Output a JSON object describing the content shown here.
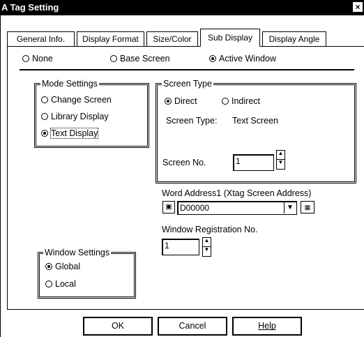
{
  "window": {
    "title": "A Tag Setting",
    "close": "×"
  },
  "tabs": [
    {
      "label": "General Info."
    },
    {
      "label": "Display Format"
    },
    {
      "label": "Size/Color"
    },
    {
      "label": "Sub Display"
    },
    {
      "label": "Display Angle"
    }
  ],
  "display_mode": {
    "none": "None",
    "base_screen": "Base Screen",
    "active_window": "Active Window"
  },
  "mode_settings": {
    "legend": "Mode Settings",
    "change_screen": "Change Screen",
    "library_display": "Library Display",
    "text_display": "Text Display",
    "selected": "Text Display"
  },
  "screen_type": {
    "legend": "Screen Type",
    "direct": "Direct",
    "indirect": "Indirect",
    "type_label": "Screen Type:",
    "type_value": "Text Screen",
    "screen_no_label": "Screen No.",
    "screen_no_value": "1"
  },
  "word_address": {
    "label": "Word Address1  (Xtag Screen Address)",
    "value": "D00000"
  },
  "window_registration": {
    "label": "Window Registration No.",
    "value": "1"
  },
  "window_settings": {
    "legend": "Window Settings",
    "global": "Global",
    "local": "Local"
  },
  "buttons": {
    "ok": "OK",
    "cancel": "Cancel",
    "help": "Help"
  }
}
